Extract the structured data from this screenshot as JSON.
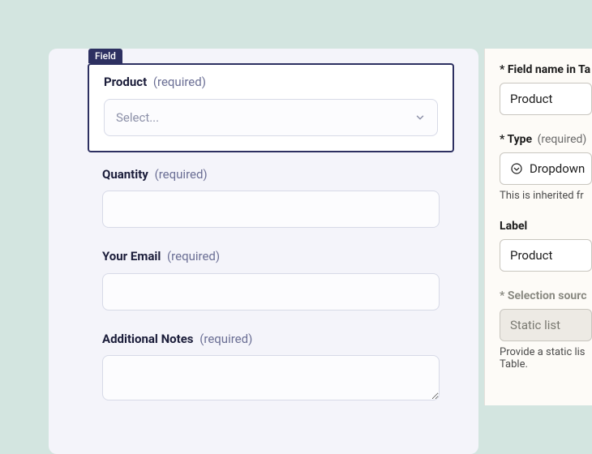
{
  "form": {
    "field_tag": "Field",
    "required_label": "(required)",
    "fields": [
      {
        "label": "Product",
        "type": "select",
        "placeholder": "Select..."
      },
      {
        "label": "Quantity",
        "type": "text"
      },
      {
        "label": "Your Email",
        "type": "text"
      },
      {
        "label": "Additional Notes",
        "type": "textarea"
      }
    ]
  },
  "sidebar": {
    "field_name": {
      "label": "Field name in Ta",
      "value": "Product"
    },
    "type": {
      "label": "Type",
      "req": "(required)",
      "value": "Dropdown",
      "helper": "This is inherited fr"
    },
    "label_field": {
      "label": "Label",
      "value": "Product"
    },
    "selection_source": {
      "label": "Selection sourc",
      "value": "Static list",
      "helper": "Provide a static lis",
      "helper2": "Table."
    }
  }
}
